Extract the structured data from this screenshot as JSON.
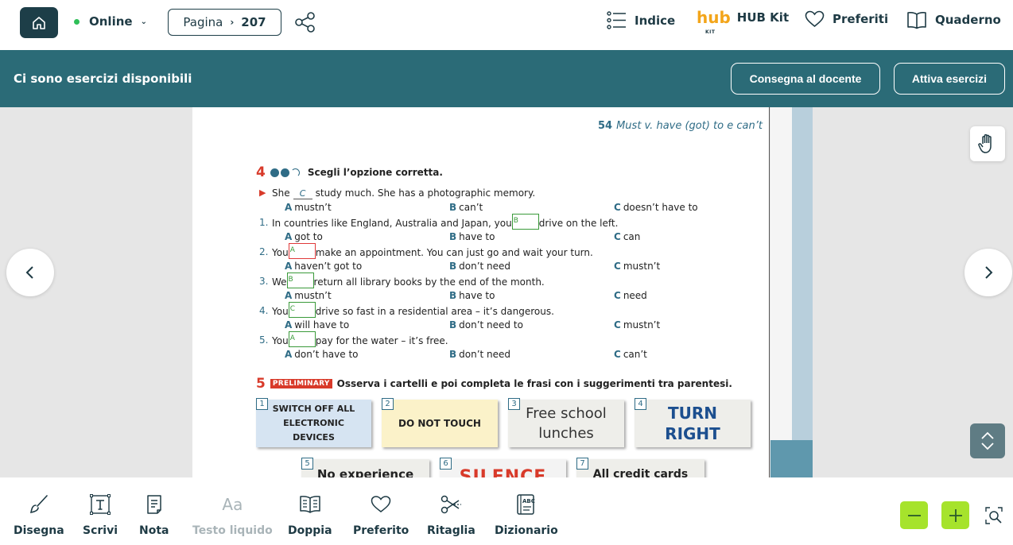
{
  "topbar": {
    "status": "Online",
    "page_label": "Pagina",
    "page_number": "207",
    "indice_label": "Indice",
    "hub_logo_text": "hub",
    "hub_logo_sub": "KIT",
    "hubkit_label": "HUB Kit",
    "preferiti_label": "Preferiti",
    "quaderno_label": "Quaderno"
  },
  "banner": {
    "message": "Ci sono esercizi disponibili",
    "consegna_label": "Consegna al docente",
    "attiva_label": "Attiva esercizi"
  },
  "page": {
    "chapter_number": "54",
    "chapter_title": "Must v. have (got) to e can’t",
    "exercise4": {
      "number": "4",
      "instruction": "Scegli l’opzione corretta.",
      "example": {
        "before": "She",
        "answer": "C",
        "after": "study much. She has a photographic memory.",
        "options": [
          "mustn’t",
          "can’t",
          "doesn’t have to"
        ]
      },
      "questions": [
        {
          "index": "1.",
          "before": "In countries like England, Australia and Japan, you",
          "answer": "B",
          "after": "drive on the left.",
          "options": [
            "got to",
            "have to",
            "can"
          ]
        },
        {
          "index": "2.",
          "before": "You",
          "answer": "A",
          "after": "make an appointment. You can just go and wait your turn.",
          "options": [
            "haven’t got to",
            "don’t need",
            "mustn’t"
          ]
        },
        {
          "index": "3.",
          "before": "We",
          "answer": "B",
          "after": "return all library books by the end of the month.",
          "options": [
            "mustn’t",
            "have to",
            "need"
          ]
        },
        {
          "index": "4.",
          "before": "You",
          "answer": "C",
          "after": "drive so fast in a residential area – it’s dangerous.",
          "options": [
            "will have to",
            "don’t need to",
            "mustn’t"
          ]
        },
        {
          "index": "5.",
          "before": "You",
          "answer": "A",
          "after": "pay for the water – it’s free.",
          "options": [
            "don’t have to",
            "don’t need",
            "can’t"
          ]
        }
      ],
      "option_letters": [
        "A",
        "B",
        "C"
      ]
    },
    "exercise5": {
      "number": "5",
      "tag": "PRELIMINARY",
      "instruction": "Osserva i cartelli e poi completa le frasi con i suggerimenti tra parentesi.",
      "signs": [
        {
          "n": "1",
          "text": "SWITCH OFF ALL ELECTRONIC DEVICES"
        },
        {
          "n": "2",
          "text": "DO NOT TOUCH"
        },
        {
          "n": "3",
          "text": "Free school lunches"
        },
        {
          "n": "4",
          "text": "TURN RIGHT"
        },
        {
          "n": "5",
          "text": "No experience"
        },
        {
          "n": "6",
          "text": "SILENCE"
        },
        {
          "n": "7",
          "text": "All credit cards"
        }
      ]
    }
  },
  "toolbar": {
    "disegna": "Disegna",
    "scrivi": "Scrivi",
    "nota": "Nota",
    "testo_liquido": "Testo liquido",
    "testo_icon": "Aa",
    "doppia": "Doppia",
    "preferito": "Preferito",
    "ritaglia": "Ritaglia",
    "dizionario": "Dizionario"
  }
}
